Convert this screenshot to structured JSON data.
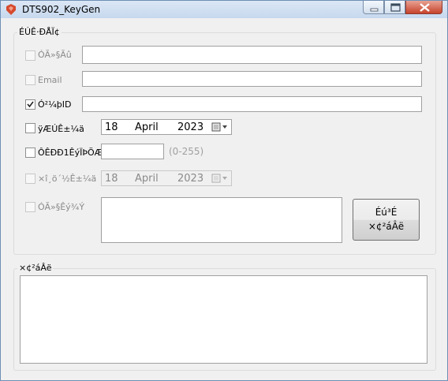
{
  "window": {
    "title": "DTS902_KeyGen"
  },
  "settings_group": {
    "label": "ÉÚÊ·ÐÅÏ¢",
    "fields": [
      {
        "label": "ÓÃ»§Ãû",
        "checked": false,
        "enabled": false,
        "value": ""
      },
      {
        "label": "Email",
        "checked": false,
        "enabled": false,
        "value": ""
      },
      {
        "label": "Ó²¼þID",
        "checked": true,
        "enabled": true,
        "value": ""
      }
    ],
    "expire": {
      "label": "ÿÆÚÊ±¼ä",
      "day": "18",
      "month": "April",
      "year": "2023"
    },
    "count": {
      "label": "ÔÊÐÐ1ÊýÏÞÖÆ",
      "value": "",
      "hint": "(0-255)"
    },
    "max_time": {
      "label": "×î¸ö´½Ê±¼ä",
      "day": "18",
      "month": "April",
      "year": "2023"
    },
    "extra": {
      "label": "ÓÃ»§Êý¾Ý",
      "value": ""
    }
  },
  "generate_button": {
    "line1": "Éú³É",
    "line2": "×¢²áÂë"
  },
  "result_group": {
    "label": "×¢²áÂë",
    "value": ""
  },
  "icons": {
    "app": "keygen-app-icon",
    "calendar": "calendar-dropdown-icon"
  },
  "colors": {
    "accent": "#d64a2e"
  }
}
